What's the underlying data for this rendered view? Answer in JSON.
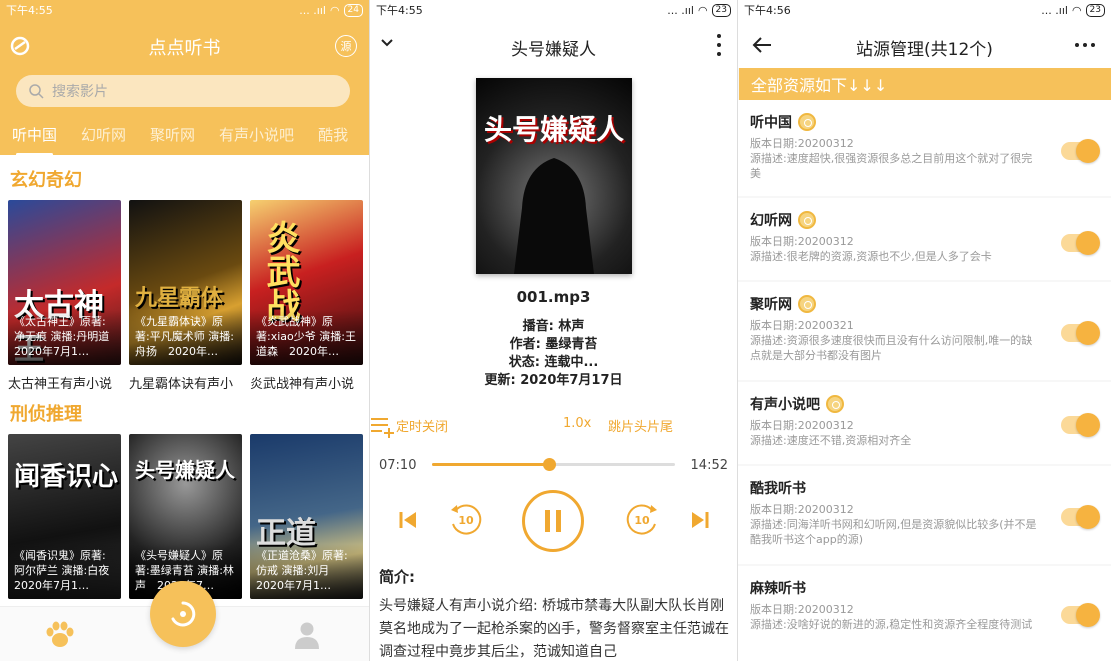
{
  "screen1": {
    "status": {
      "time": "下午4:55",
      "signal": "... .ııl",
      "battery": "24"
    },
    "title": "点点听书",
    "source_icon_label": "源",
    "search": {
      "placeholder": "搜索影片"
    },
    "tabs": [
      "听中国",
      "幻听网",
      "聚听网",
      "有声小说吧",
      "酷我"
    ],
    "sections": [
      {
        "title": "玄幻奇幻",
        "cards": [
          {
            "caption": "《太古神王》原著:净无痕 演播:丹明道　2020年7月1…",
            "cover_text": "太古神王",
            "name": "太古神王有声小说"
          },
          {
            "caption": "《九星霸体诀》原著:平凡魔术师 演播:舟扬　2020年…",
            "cover_text": "九星霸体",
            "name": "九星霸体诀有声小"
          },
          {
            "caption": "《炎武战神》原著:xiao少爷 演播:王道森　2020年…",
            "cover_text": "炎武战",
            "name": "炎武战神有声小说"
          }
        ]
      },
      {
        "title": "刑侦推理",
        "cards": [
          {
            "caption": "《闻香识鬼》原著:阿尔萨兰 演播:白夜　2020年7月1…",
            "cover_text": "闻香识心"
          },
          {
            "caption": "《头号嫌疑人》原著:墨绿青苔 演播:林声　2020年7…",
            "cover_text": "头号嫌疑人"
          },
          {
            "caption": "《正道沧桑》原著:仿戒 演播:刘月　2020年7月1…",
            "cover_text": "正道"
          }
        ]
      }
    ]
  },
  "screen2": {
    "status": {
      "time": "下午4:55",
      "signal": "... .ııl",
      "battery": "23"
    },
    "title": "头号嫌疑人",
    "cover_text": "头号嫌疑人",
    "track": "001.mp3",
    "narrator": "播音: 林声",
    "author": "作者: 墨绿青苔",
    "state": "状态: 连载中...",
    "updated": "更新: 2020年7月17日",
    "timer_label": "定时关闭",
    "speed_label": "1.0x",
    "skip_label": "跳片头片尾",
    "current_time": "07:10",
    "total_time": "14:52",
    "progress": 0.48,
    "rewind_label": "10",
    "forward_label": "10",
    "intro_title": "简介:",
    "intro_text": "头号嫌疑人有声小说介绍: 桥城市禁毒大队副大队长肖刚莫名地成为了一起枪杀案的凶手，警务督察室主任范诚在调查过程中竟步其后尘，范诚知道自己"
  },
  "screen3": {
    "status": {
      "time": "下午4:56",
      "signal": "... .ııl",
      "battery": "23"
    },
    "title": "站源管理(共12个)",
    "banner": "全部资源如下↓↓↓",
    "sources": [
      {
        "name": "听中国",
        "date": "版本日期:20200312",
        "desc": "源描述:速度超快,很强资源很多总之目前用这个就对了很完美",
        "enabled": true
      },
      {
        "name": "幻听网",
        "date": "版本日期:20200312",
        "desc": "源描述:很老牌的资源,资源也不少,但是人多了会卡",
        "enabled": true
      },
      {
        "name": "聚听网",
        "date": "版本日期:20200321",
        "desc": "源描述:资源很多速度很快而且没有什么访问限制,唯一的缺点就是大部分书都没有图片",
        "enabled": true
      },
      {
        "name": "有声小说吧",
        "date": "版本日期:20200312",
        "desc": "源描述:速度还不错,资源相对齐全",
        "enabled": true
      },
      {
        "name": "酷我听书",
        "date": "版本日期:20200312",
        "desc": "源描述:同海洋听书网和幻听网,但是资源貌似比较多(并不是酷我听书这个app的源)",
        "enabled": true
      },
      {
        "name": "麻辣听书",
        "date": "版本日期:20200312",
        "desc": "源描述:没啥好说的新进的源,稳定性和资源齐全程度待测试",
        "enabled": true
      }
    ]
  },
  "colors": {
    "accent": "#f6c15a",
    "accent_text": "#f0a830"
  }
}
